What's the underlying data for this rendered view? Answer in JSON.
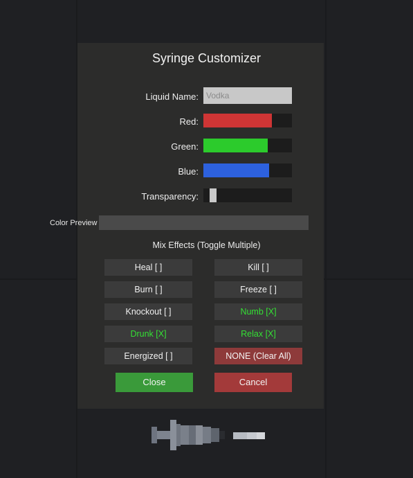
{
  "dialog": {
    "title": "Syringe Customizer",
    "liquid_name_label": "Liquid Name:",
    "liquid_name_value": "Vodka",
    "red_label": "Red:",
    "green_label": "Green:",
    "blue_label": "Blue:",
    "transparency_label": "Transparency:",
    "color_preview_label": "Color Preview",
    "mix_effects_title": "Mix Effects (Toggle Multiple)"
  },
  "sliders": {
    "red": 0.77,
    "green": 0.73,
    "blue": 0.74,
    "transparency": 0.08
  },
  "colors": {
    "red_fill": "#cf3535",
    "green_fill": "#2ccb2c",
    "blue_fill": "#2d61de",
    "effect_active_text": "#34e034",
    "none_button_bg": "#8e3a3a",
    "close_button_bg": "#3a9a3a",
    "cancel_button_bg": "#a33a3a",
    "preview_color": "#4a4a4a"
  },
  "effects": [
    {
      "label": "Heal [ ]",
      "active": false
    },
    {
      "label": "Kill [ ]",
      "active": false
    },
    {
      "label": "Burn [ ]",
      "active": false
    },
    {
      "label": "Freeze [ ]",
      "active": false
    },
    {
      "label": "Knockout [ ]",
      "active": false
    },
    {
      "label": "Numb [X]",
      "active": true
    },
    {
      "label": "Drunk [X]",
      "active": true
    },
    {
      "label": "Relax [X]",
      "active": true
    },
    {
      "label": "Energized [ ]",
      "active": false
    },
    {
      "label": "NONE (Clear All)",
      "active": false
    }
  ],
  "buttons": {
    "close": "Close",
    "cancel": "Cancel"
  },
  "syringe": {
    "icon": "syringe-icon"
  }
}
